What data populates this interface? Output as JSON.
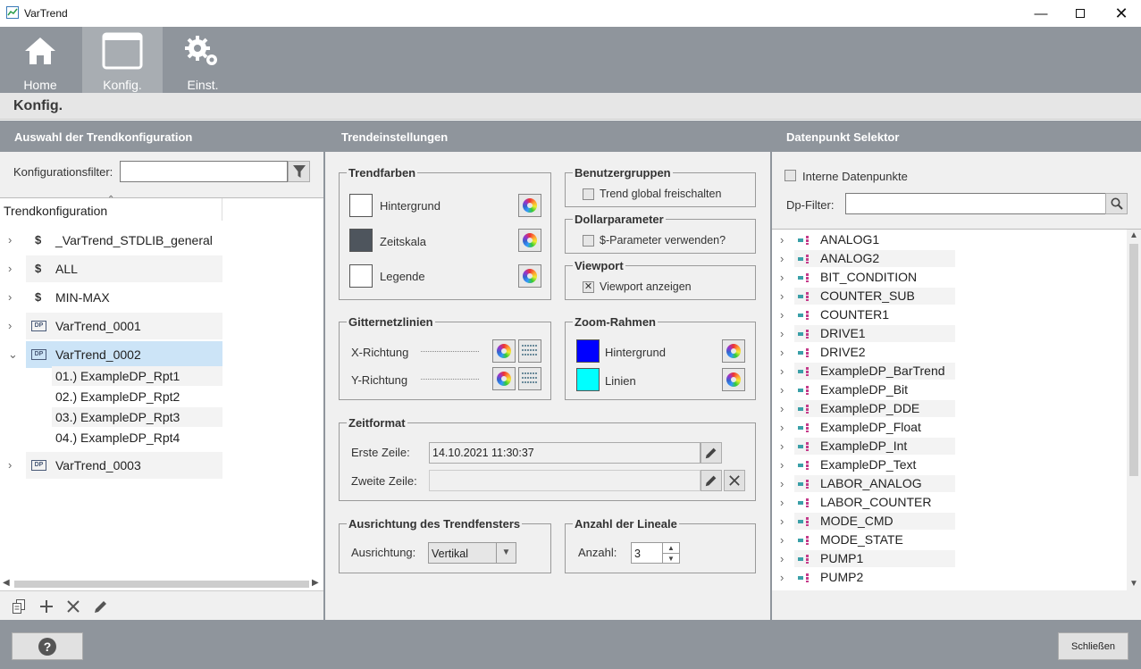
{
  "window": {
    "title": "VarTrend"
  },
  "nav": {
    "home": "Home",
    "konfig": "Konfig.",
    "einst": "Einst."
  },
  "page": {
    "title": "Konfig."
  },
  "left": {
    "header": "Auswahl der Trendkonfiguration",
    "filter_label": "Konfigurationsfilter:",
    "filter_value": "",
    "column": "Trendkonfiguration",
    "items": [
      {
        "label": "_VarTrend_STDLIB_general",
        "type": "$"
      },
      {
        "label": "ALL",
        "type": "$"
      },
      {
        "label": "MIN-MAX",
        "type": "$"
      },
      {
        "label": "VarTrend_0001",
        "type": "DP"
      },
      {
        "label": "VarTrend_0002",
        "type": "DP",
        "expanded": true,
        "selected": true
      },
      {
        "label": "VarTrend_0003",
        "type": "DP"
      }
    ],
    "children": [
      "01.) ExampleDP_Rpt1",
      "02.) ExampleDP_Rpt2",
      "03.) ExampleDP_Rpt3",
      "04.) ExampleDP_Rpt4"
    ]
  },
  "middle": {
    "header": "Trendeinstellungen",
    "trendfarben": {
      "title": "Trendfarben",
      "hintergrund": "Hintergrund",
      "zeitskala": "Zeitskala",
      "legende": "Legende",
      "colors": [
        "#ffffff",
        "#4e555d",
        "#ffffff"
      ]
    },
    "benutzergruppen": {
      "title": "Benutzergruppen",
      "label": "Trend global freischalten",
      "checked": false
    },
    "dollar": {
      "title": "Dollarparameter",
      "label": "$-Parameter verwenden?",
      "checked": false
    },
    "viewport": {
      "title": "Viewport",
      "label": "Viewport anzeigen",
      "checked": true
    },
    "gitter": {
      "title": "Gitternetzlinien",
      "x": "X-Richtung",
      "y": "Y-Richtung"
    },
    "zoom": {
      "title": "Zoom-Rahmen",
      "hintergrund": "Hintergrund",
      "linien": "Linien",
      "colors": [
        "#0000ff",
        "#00ffff"
      ]
    },
    "zeitformat": {
      "title": "Zeitformat",
      "erste_label": "Erste Zeile:",
      "erste_value": "14.10.2021 11:30:37",
      "zweite_label": "Zweite Zeile:",
      "zweite_value": ""
    },
    "ausrichtung": {
      "title": "Ausrichtung des Trendfensters",
      "label": "Ausrichtung:",
      "value": "Vertikal"
    },
    "lineale": {
      "title": "Anzahl der Lineale",
      "label": "Anzahl:",
      "value": "3"
    }
  },
  "right": {
    "header": "Datenpunkt Selektor",
    "interne": "Interne Datenpunkte",
    "filter_label": "Dp-Filter:",
    "filter_value": "",
    "items": [
      "ANALOG1",
      "ANALOG2",
      "BIT_CONDITION",
      "COUNTER_SUB",
      "COUNTER1",
      "DRIVE1",
      "DRIVE2",
      "ExampleDP_BarTrend",
      "ExampleDP_Bit",
      "ExampleDP_DDE",
      "ExampleDP_Float",
      "ExampleDP_Int",
      "ExampleDP_Text",
      "LABOR_ANALOG",
      "LABOR_COUNTER",
      "MODE_CMD",
      "MODE_STATE",
      "PUMP1",
      "PUMP2"
    ]
  },
  "bottom": {
    "help": "?",
    "close": "Schließen"
  }
}
